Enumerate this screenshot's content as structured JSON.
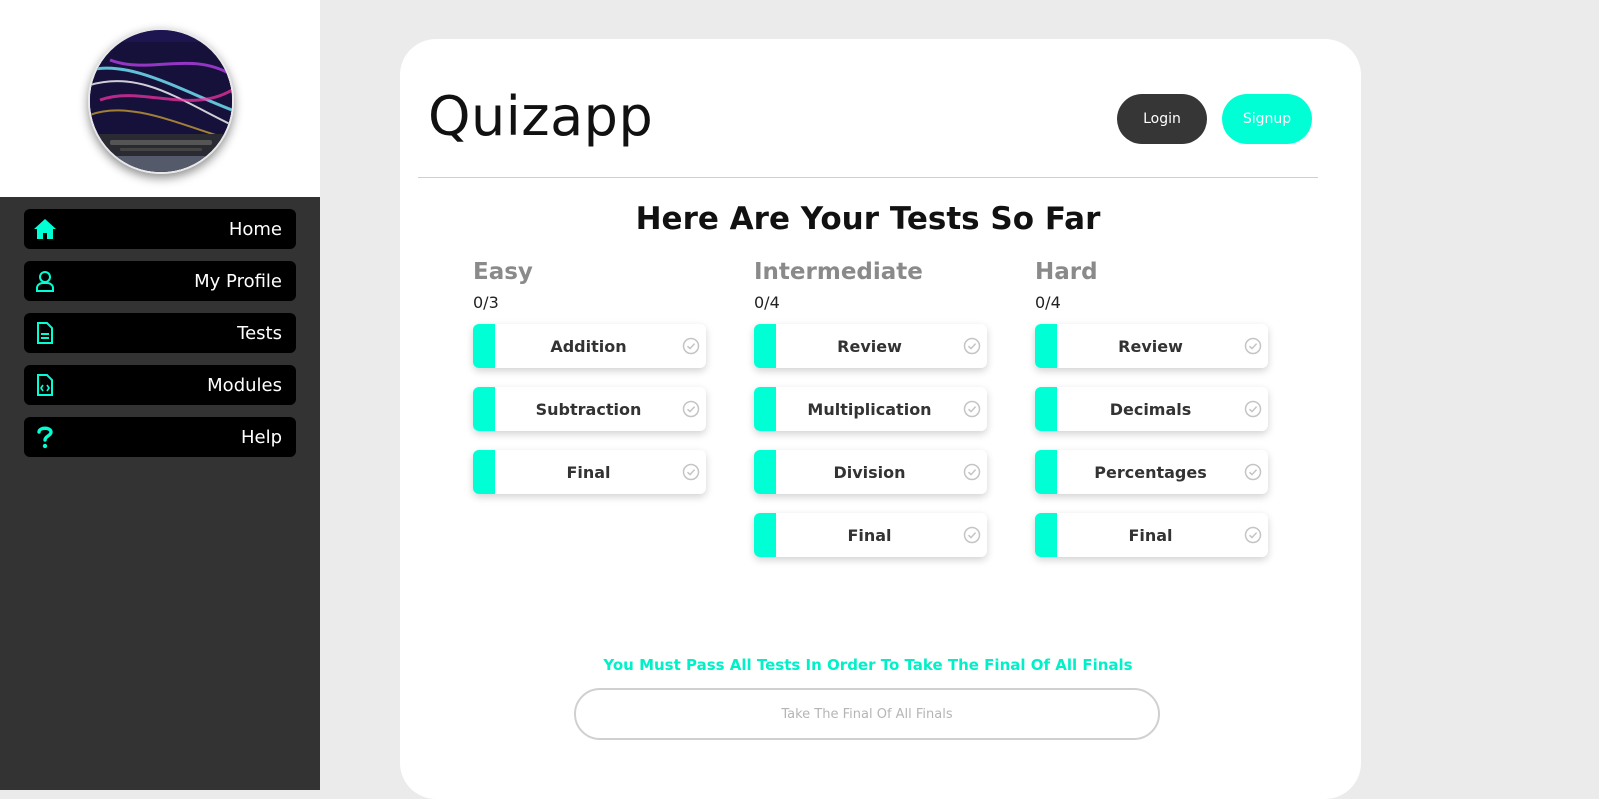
{
  "colors": {
    "accent": "#00ffd5",
    "sidebar_bg": "#333333",
    "nav_bg": "#000000",
    "login_bg": "#363636"
  },
  "sidebar": {
    "avatar_icon": "laptop-photo",
    "items": [
      {
        "label": "Home",
        "icon": "home-icon"
      },
      {
        "label": "My Profile",
        "icon": "user-icon"
      },
      {
        "label": "Tests",
        "icon": "document-icon"
      },
      {
        "label": "Modules",
        "icon": "code-file-icon"
      },
      {
        "label": "Help",
        "icon": "question-icon"
      }
    ]
  },
  "header": {
    "brand": "Quizapp",
    "login_label": "Login",
    "signup_label": "Signup"
  },
  "main": {
    "title": "Here Are Your Tests So Far",
    "columns": [
      {
        "title": "Easy",
        "count": "0/3",
        "tests": [
          "Addition",
          "Subtraction",
          "Final"
        ]
      },
      {
        "title": "Intermediate",
        "count": "0/4",
        "tests": [
          "Review",
          "Multiplication",
          "Division",
          "Final"
        ]
      },
      {
        "title": "Hard",
        "count": "0/4",
        "tests": [
          "Review",
          "Decimals",
          "Percentages",
          "Final"
        ]
      }
    ],
    "notice": "You Must Pass All Tests In Order To Take The Final Of All Finals",
    "final_button": "Take The Final Of All Finals"
  }
}
